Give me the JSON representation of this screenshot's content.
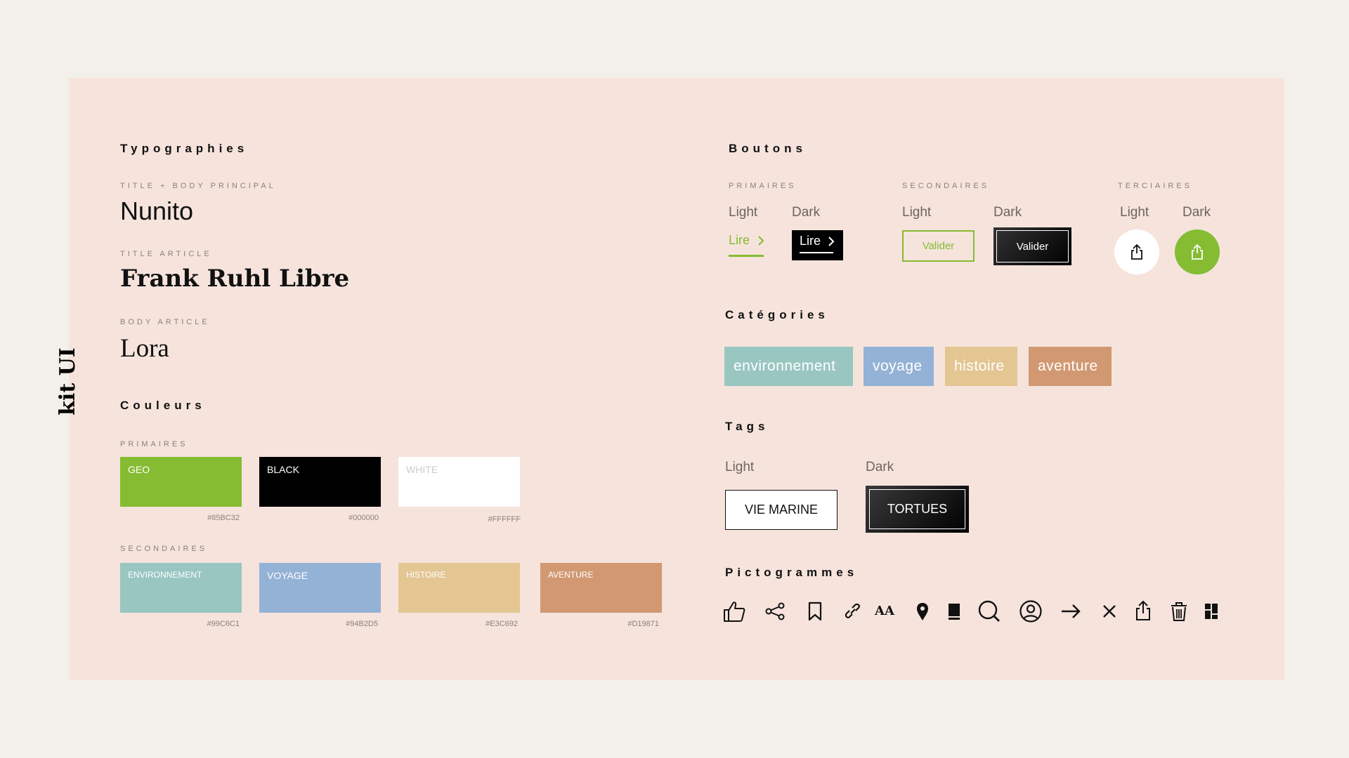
{
  "side_title": "kit UI",
  "typography": {
    "heading": "Typographies",
    "items": [
      {
        "label": "TITLE + BODY PRINCIPAL",
        "sample": "Nunito"
      },
      {
        "label": "TITLE ARTICLE",
        "sample": "Frank Ruhl Libre"
      },
      {
        "label": "BODY ARTICLE",
        "sample": "Lora"
      }
    ]
  },
  "colors": {
    "heading": "Couleurs",
    "primary_label": "PRIMAIRES",
    "primary": [
      {
        "name": "GEO",
        "hex": "#85BC32",
        "color": "#85bc32"
      },
      {
        "name": "BLACK",
        "hex": "#000000",
        "color": "#000000"
      },
      {
        "name": "WHITE",
        "hex": "#FFFFFF",
        "color": "#ffffff"
      }
    ],
    "secondary_label": "SECONDAIRES",
    "secondary": [
      {
        "name": "ENVIRONNEMENT",
        "hex": "#99C6C1",
        "color": "#99c6c1"
      },
      {
        "name": "VOYAGE",
        "hex": "#94B2D5",
        "color": "#94b2d5"
      },
      {
        "name": "HISTOIRE",
        "hex": "#E3C692",
        "color": "#e3c692"
      },
      {
        "name": "AVENTURE",
        "hex": "#D19871",
        "color": "#d19871"
      }
    ]
  },
  "buttons": {
    "heading": "Boutons",
    "primary": {
      "label": "PRIMAIRES",
      "light": "Light",
      "dark": "Dark",
      "text": "Lire"
    },
    "secondary": {
      "label": "SECONDAIRES",
      "light": "Light",
      "dark": "Dark",
      "text": "Valider"
    },
    "tertiary": {
      "label": "TERCIAIRES",
      "light": "Light",
      "dark": "Dark"
    }
  },
  "categories": {
    "heading": "Catégories",
    "items": [
      {
        "label": "environnement",
        "color": "#99c6c1"
      },
      {
        "label": "voyage",
        "color": "#94b2d5"
      },
      {
        "label": "histoire",
        "color": "#e3c692"
      },
      {
        "label": "aventure",
        "color": "#d19871"
      }
    ]
  },
  "tags": {
    "heading": "Tags",
    "light_label": "Light",
    "dark_label": "Dark",
    "light_tag": "VIE MARINE",
    "dark_tag": "TORTUES"
  },
  "pictograms": {
    "heading": "Pictogrammes",
    "icons": [
      "thumbs-up-icon",
      "share-icon",
      "bookmark-icon",
      "link-icon",
      "font-size-icon",
      "location-pin-icon",
      "book-icon",
      "search-icon",
      "user-icon",
      "arrow-right-icon",
      "close-icon",
      "export-icon",
      "trash-icon",
      "dashboard-icon"
    ],
    "text_size_glyph": "AA"
  },
  "accent": "#85bc32"
}
